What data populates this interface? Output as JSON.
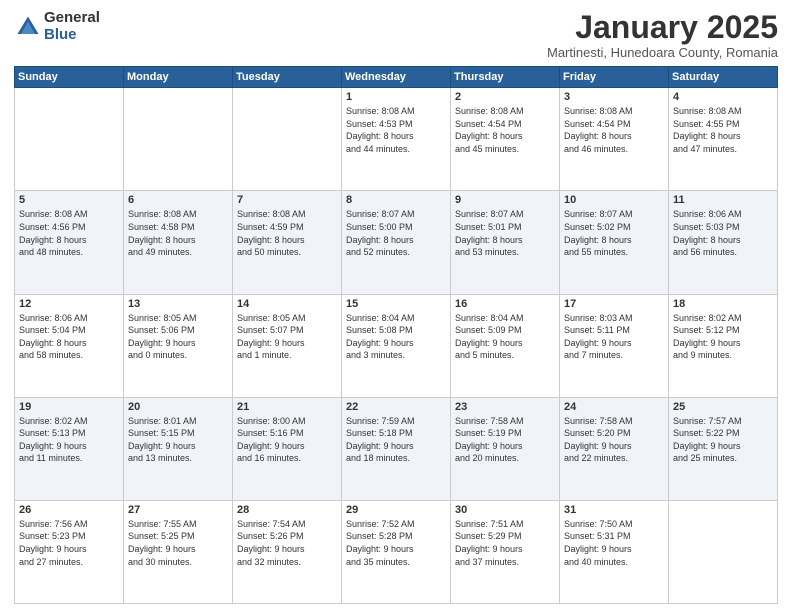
{
  "logo": {
    "general": "General",
    "blue": "Blue"
  },
  "title": "January 2025",
  "location": "Martinesti, Hunedoara County, Romania",
  "weekdays": [
    "Sunday",
    "Monday",
    "Tuesday",
    "Wednesday",
    "Thursday",
    "Friday",
    "Saturday"
  ],
  "weeks": [
    [
      {
        "day": "",
        "info": ""
      },
      {
        "day": "",
        "info": ""
      },
      {
        "day": "",
        "info": ""
      },
      {
        "day": "1",
        "info": "Sunrise: 8:08 AM\nSunset: 4:53 PM\nDaylight: 8 hours\nand 44 minutes."
      },
      {
        "day": "2",
        "info": "Sunrise: 8:08 AM\nSunset: 4:54 PM\nDaylight: 8 hours\nand 45 minutes."
      },
      {
        "day": "3",
        "info": "Sunrise: 8:08 AM\nSunset: 4:54 PM\nDaylight: 8 hours\nand 46 minutes."
      },
      {
        "day": "4",
        "info": "Sunrise: 8:08 AM\nSunset: 4:55 PM\nDaylight: 8 hours\nand 47 minutes."
      }
    ],
    [
      {
        "day": "5",
        "info": "Sunrise: 8:08 AM\nSunset: 4:56 PM\nDaylight: 8 hours\nand 48 minutes."
      },
      {
        "day": "6",
        "info": "Sunrise: 8:08 AM\nSunset: 4:58 PM\nDaylight: 8 hours\nand 49 minutes."
      },
      {
        "day": "7",
        "info": "Sunrise: 8:08 AM\nSunset: 4:59 PM\nDaylight: 8 hours\nand 50 minutes."
      },
      {
        "day": "8",
        "info": "Sunrise: 8:07 AM\nSunset: 5:00 PM\nDaylight: 8 hours\nand 52 minutes."
      },
      {
        "day": "9",
        "info": "Sunrise: 8:07 AM\nSunset: 5:01 PM\nDaylight: 8 hours\nand 53 minutes."
      },
      {
        "day": "10",
        "info": "Sunrise: 8:07 AM\nSunset: 5:02 PM\nDaylight: 8 hours\nand 55 minutes."
      },
      {
        "day": "11",
        "info": "Sunrise: 8:06 AM\nSunset: 5:03 PM\nDaylight: 8 hours\nand 56 minutes."
      }
    ],
    [
      {
        "day": "12",
        "info": "Sunrise: 8:06 AM\nSunset: 5:04 PM\nDaylight: 8 hours\nand 58 minutes."
      },
      {
        "day": "13",
        "info": "Sunrise: 8:05 AM\nSunset: 5:06 PM\nDaylight: 9 hours\nand 0 minutes."
      },
      {
        "day": "14",
        "info": "Sunrise: 8:05 AM\nSunset: 5:07 PM\nDaylight: 9 hours\nand 1 minute."
      },
      {
        "day": "15",
        "info": "Sunrise: 8:04 AM\nSunset: 5:08 PM\nDaylight: 9 hours\nand 3 minutes."
      },
      {
        "day": "16",
        "info": "Sunrise: 8:04 AM\nSunset: 5:09 PM\nDaylight: 9 hours\nand 5 minutes."
      },
      {
        "day": "17",
        "info": "Sunrise: 8:03 AM\nSunset: 5:11 PM\nDaylight: 9 hours\nand 7 minutes."
      },
      {
        "day": "18",
        "info": "Sunrise: 8:02 AM\nSunset: 5:12 PM\nDaylight: 9 hours\nand 9 minutes."
      }
    ],
    [
      {
        "day": "19",
        "info": "Sunrise: 8:02 AM\nSunset: 5:13 PM\nDaylight: 9 hours\nand 11 minutes."
      },
      {
        "day": "20",
        "info": "Sunrise: 8:01 AM\nSunset: 5:15 PM\nDaylight: 9 hours\nand 13 minutes."
      },
      {
        "day": "21",
        "info": "Sunrise: 8:00 AM\nSunset: 5:16 PM\nDaylight: 9 hours\nand 16 minutes."
      },
      {
        "day": "22",
        "info": "Sunrise: 7:59 AM\nSunset: 5:18 PM\nDaylight: 9 hours\nand 18 minutes."
      },
      {
        "day": "23",
        "info": "Sunrise: 7:58 AM\nSunset: 5:19 PM\nDaylight: 9 hours\nand 20 minutes."
      },
      {
        "day": "24",
        "info": "Sunrise: 7:58 AM\nSunset: 5:20 PM\nDaylight: 9 hours\nand 22 minutes."
      },
      {
        "day": "25",
        "info": "Sunrise: 7:57 AM\nSunset: 5:22 PM\nDaylight: 9 hours\nand 25 minutes."
      }
    ],
    [
      {
        "day": "26",
        "info": "Sunrise: 7:56 AM\nSunset: 5:23 PM\nDaylight: 9 hours\nand 27 minutes."
      },
      {
        "day": "27",
        "info": "Sunrise: 7:55 AM\nSunset: 5:25 PM\nDaylight: 9 hours\nand 30 minutes."
      },
      {
        "day": "28",
        "info": "Sunrise: 7:54 AM\nSunset: 5:26 PM\nDaylight: 9 hours\nand 32 minutes."
      },
      {
        "day": "29",
        "info": "Sunrise: 7:52 AM\nSunset: 5:28 PM\nDaylight: 9 hours\nand 35 minutes."
      },
      {
        "day": "30",
        "info": "Sunrise: 7:51 AM\nSunset: 5:29 PM\nDaylight: 9 hours\nand 37 minutes."
      },
      {
        "day": "31",
        "info": "Sunrise: 7:50 AM\nSunset: 5:31 PM\nDaylight: 9 hours\nand 40 minutes."
      },
      {
        "day": "",
        "info": ""
      }
    ]
  ]
}
